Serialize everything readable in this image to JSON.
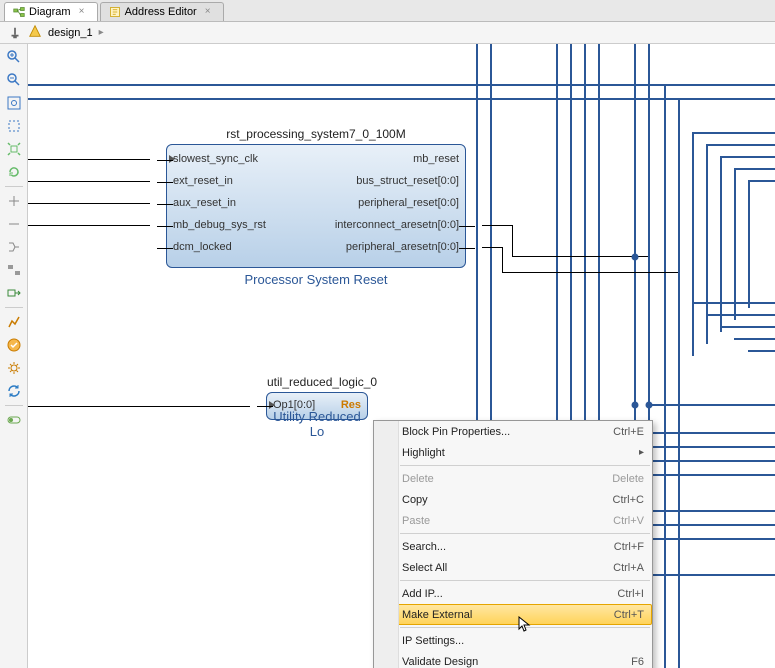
{
  "tabs": [
    {
      "label": "Diagram",
      "active": true
    },
    {
      "label": "Address Editor",
      "active": false
    }
  ],
  "breadcrumb": {
    "root": "design_1"
  },
  "block1": {
    "title": "rst_processing_system7_0_100M",
    "subtitle": "Processor System Reset",
    "left_pins": [
      "slowest_sync_clk",
      "ext_reset_in",
      "aux_reset_in",
      "mb_debug_sys_rst",
      "dcm_locked"
    ],
    "right_pins": [
      "mb_reset",
      "bus_struct_reset[0:0]",
      "peripheral_reset[0:0]",
      "interconnect_aresetn[0:0]",
      "peripheral_aresetn[0:0]"
    ]
  },
  "block2": {
    "title": "util_reduced_logic_0",
    "subtitle": "Utility Reduced Lo",
    "left_pin": "Op1[0:0]",
    "right_pin": "Res"
  },
  "context_menu": {
    "items": [
      {
        "label": "Block Pin Properties...",
        "shortcut": "Ctrl+E",
        "enabled": true,
        "icon": "properties-icon"
      },
      {
        "label": "Highlight",
        "shortcut": "",
        "enabled": true,
        "icon": "highlight-icon",
        "submenu": true
      },
      {
        "label": "Delete",
        "shortcut": "Delete",
        "enabled": false,
        "icon": "delete-icon"
      },
      {
        "label": "Copy",
        "shortcut": "Ctrl+C",
        "enabled": true,
        "icon": "copy-icon"
      },
      {
        "label": "Paste",
        "shortcut": "Ctrl+V",
        "enabled": false,
        "icon": "paste-icon"
      },
      {
        "label": "Search...",
        "shortcut": "Ctrl+F",
        "enabled": true,
        "icon": "search-icon"
      },
      {
        "label": "Select All",
        "shortcut": "Ctrl+A",
        "enabled": true,
        "icon": "blank-icon"
      },
      {
        "label": "Add IP...",
        "shortcut": "Ctrl+I",
        "enabled": true,
        "icon": "add-ip-icon"
      },
      {
        "label": "Make External",
        "shortcut": "Ctrl+T",
        "enabled": true,
        "icon": "make-external-icon",
        "hovered": true
      },
      {
        "label": "IP Settings...",
        "shortcut": "",
        "enabled": true,
        "icon": "settings-icon"
      },
      {
        "label": "Validate Design",
        "shortcut": "F6",
        "enabled": true,
        "icon": "validate-icon"
      }
    ]
  }
}
